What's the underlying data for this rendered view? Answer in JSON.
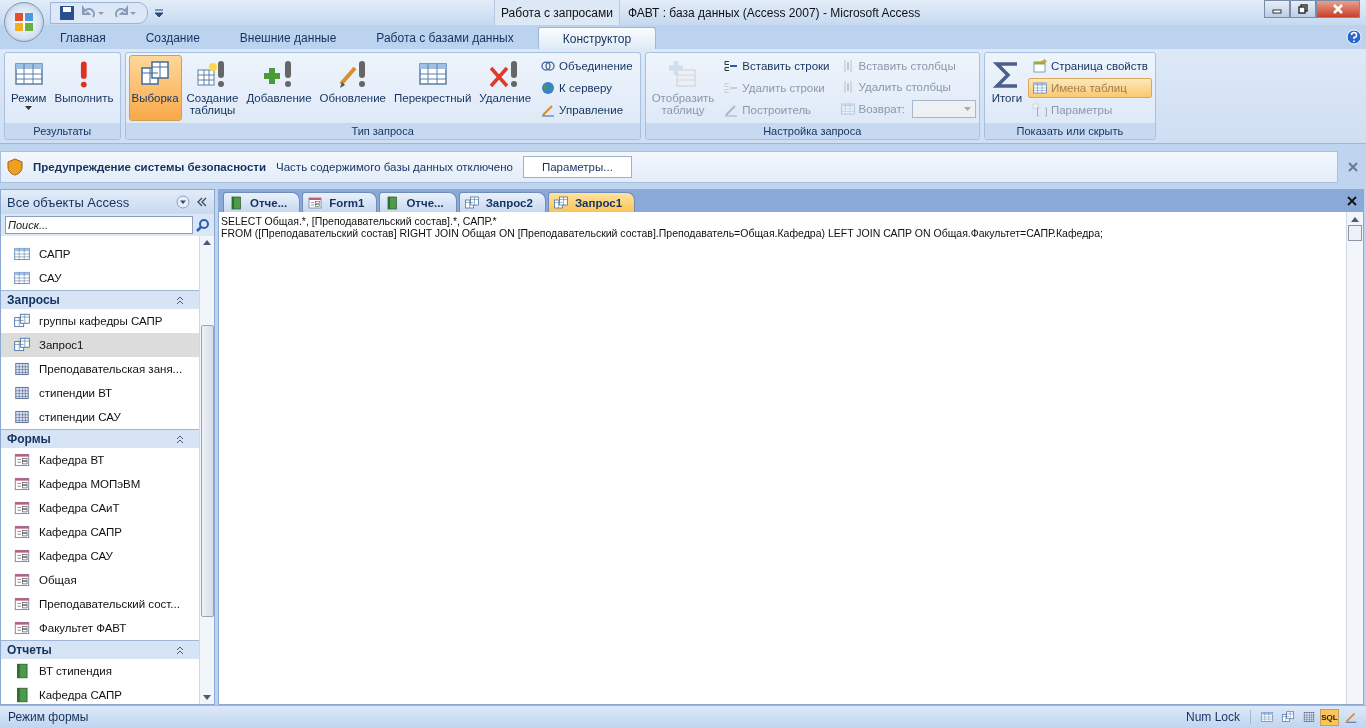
{
  "window": {
    "title": "ФАВТ : база данных (Access 2007)  -  Microsoft Access",
    "context_tab": "Работа с запросами"
  },
  "ribbon_tabs": [
    {
      "label": "Главная",
      "selected": false
    },
    {
      "label": "Создание",
      "selected": false
    },
    {
      "label": "Внешние данные",
      "selected": false
    },
    {
      "label": "Работа с базами данных",
      "selected": false
    },
    {
      "label": "Конструктор",
      "selected": true
    }
  ],
  "ribbon_groups": [
    {
      "label": "Результаты",
      "items": [
        {
          "kind": "large",
          "label": "Режим",
          "dropdown": true,
          "disabled": false
        },
        {
          "kind": "large",
          "label": "Выполнить",
          "dropdown": false,
          "disabled": false
        }
      ]
    },
    {
      "label": "Тип запроса",
      "items": [
        {
          "kind": "large",
          "label": "Выборка",
          "dropdown": false,
          "disabled": false,
          "selected": true
        },
        {
          "kind": "large",
          "label": "Создание таблицы",
          "dropdown": false,
          "disabled": false,
          "selected": false
        },
        {
          "kind": "large",
          "label": "Добавление",
          "dropdown": false,
          "disabled": false,
          "selected": false
        },
        {
          "kind": "large",
          "label": "Обновление",
          "dropdown": false,
          "disabled": false,
          "selected": false
        },
        {
          "kind": "large",
          "label": "Перекрестный",
          "dropdown": false,
          "disabled": false,
          "selected": false
        },
        {
          "kind": "large",
          "label": "Удаление",
          "dropdown": false,
          "disabled": false,
          "selected": false
        },
        {
          "kind": "stack",
          "buttons": [
            {
              "kind": "small",
              "label": "Объединение",
              "disabled": false
            },
            {
              "kind": "small",
              "label": "К серверу",
              "disabled": false
            },
            {
              "kind": "small",
              "label": "Управление",
              "disabled": false
            }
          ]
        }
      ]
    },
    {
      "label": "Настройка запроса",
      "items": [
        {
          "kind": "large",
          "label": "Отобразить таблицу",
          "dropdown": false,
          "disabled": true
        },
        {
          "kind": "stack",
          "buttons": [
            {
              "kind": "small",
              "label": "Вставить строки",
              "disabled": false
            },
            {
              "kind": "small",
              "label": "Удалить строки",
              "disabled": true
            },
            {
              "kind": "small",
              "label": "Построитель",
              "disabled": true
            }
          ]
        },
        {
          "kind": "stack",
          "buttons": [
            {
              "kind": "small",
              "label": "Вставить столбцы",
              "disabled": true
            },
            {
              "kind": "small",
              "label": "Удалить столбцы",
              "disabled": true
            },
            {
              "kind": "combo",
              "label": "Возврат:",
              "disabled": true
            }
          ]
        }
      ]
    },
    {
      "label": "Показать или скрыть",
      "items": [
        {
          "kind": "large",
          "label": "Итоги",
          "dropdown": false,
          "disabled": false,
          "selected": false
        },
        {
          "kind": "stack",
          "buttons": [
            {
              "kind": "small",
              "label": "Страница свойств",
              "disabled": false,
              "selected": false
            },
            {
              "kind": "small",
              "label": "Имена таблиц",
              "disabled": false,
              "selected": true
            },
            {
              "kind": "small",
              "label": "Параметры",
              "disabled": true,
              "selected": false
            }
          ]
        }
      ]
    }
  ],
  "security_bar": {
    "title": "Предупреждение системы безопасности",
    "message": "Часть содержимого базы данных отключено",
    "button": "Параметры..."
  },
  "nav_pane": {
    "title": "Все объекты Access",
    "search": {
      "placeholder": "Поиск..."
    },
    "sections": [
      {
        "items": [
          {
            "label": "САПР",
            "kind": "table",
            "selected": false
          },
          {
            "label": "САУ",
            "kind": "table",
            "selected": false
          }
        ]
      },
      {
        "title": "Запросы",
        "items": [
          {
            "label": "группы кафедры САПР",
            "kind": "query",
            "selected": false
          },
          {
            "label": "Запрос1",
            "kind": "query",
            "selected": true
          },
          {
            "label": "Преподавательская заня...",
            "kind": "crosstab",
            "selected": false
          },
          {
            "label": "стипендии ВТ",
            "kind": "crosstab",
            "selected": false
          },
          {
            "label": "стипендии САУ",
            "kind": "crosstab",
            "selected": false
          }
        ]
      },
      {
        "title": "Формы",
        "items": [
          {
            "label": "Кафедра ВТ",
            "kind": "form",
            "selected": false
          },
          {
            "label": "Кафедра МОПэВМ",
            "kind": "form",
            "selected": false
          },
          {
            "label": "Кафедра САиТ",
            "kind": "form",
            "selected": false
          },
          {
            "label": "Кафедра САПР",
            "kind": "form",
            "selected": false
          },
          {
            "label": "Кафедра САУ",
            "kind": "form",
            "selected": false
          },
          {
            "label": "Общая",
            "kind": "form",
            "selected": false
          },
          {
            "label": "Преподавательский сост...",
            "kind": "form",
            "selected": false
          },
          {
            "label": "Факультет ФАВТ",
            "kind": "form",
            "selected": false
          }
        ]
      },
      {
        "title": "Отчеты",
        "items": [
          {
            "label": "ВТ стипендия",
            "kind": "report",
            "selected": false
          },
          {
            "label": "Кафедра САПР",
            "kind": "report",
            "selected": false
          }
        ]
      }
    ]
  },
  "document_tabs": [
    {
      "label": "Отче...",
      "kind": "report",
      "selected": false
    },
    {
      "label": "Form1",
      "kind": "form",
      "selected": false
    },
    {
      "label": "Отче...",
      "kind": "report",
      "selected": false
    },
    {
      "label": "Запрос2",
      "kind": "query",
      "selected": false
    },
    {
      "label": "Запрос1",
      "kind": "query",
      "selected": true
    }
  ],
  "sql_lines": [
    "SELECT Общая.*, [Преподавательский состав].*, САПР.*",
    "FROM ([Преподавательский состав] RIGHT JOIN Общая ON [Преподавательский состав].Преподаватель=Общая.Кафедра) LEFT JOIN САПР ON Общая.Факультет=САПР.Кафедра;"
  ],
  "status_bar": {
    "mode": "Режим формы",
    "num_lock": "Num Lock",
    "views": [
      {
        "kind": "datasheet",
        "selected": false
      },
      {
        "kind": "pivot-table",
        "selected": false
      },
      {
        "kind": "pivot-chart",
        "selected": false
      },
      {
        "kind": "sql",
        "label": "SQL",
        "selected": true
      },
      {
        "kind": "design",
        "selected": false
      }
    ]
  }
}
